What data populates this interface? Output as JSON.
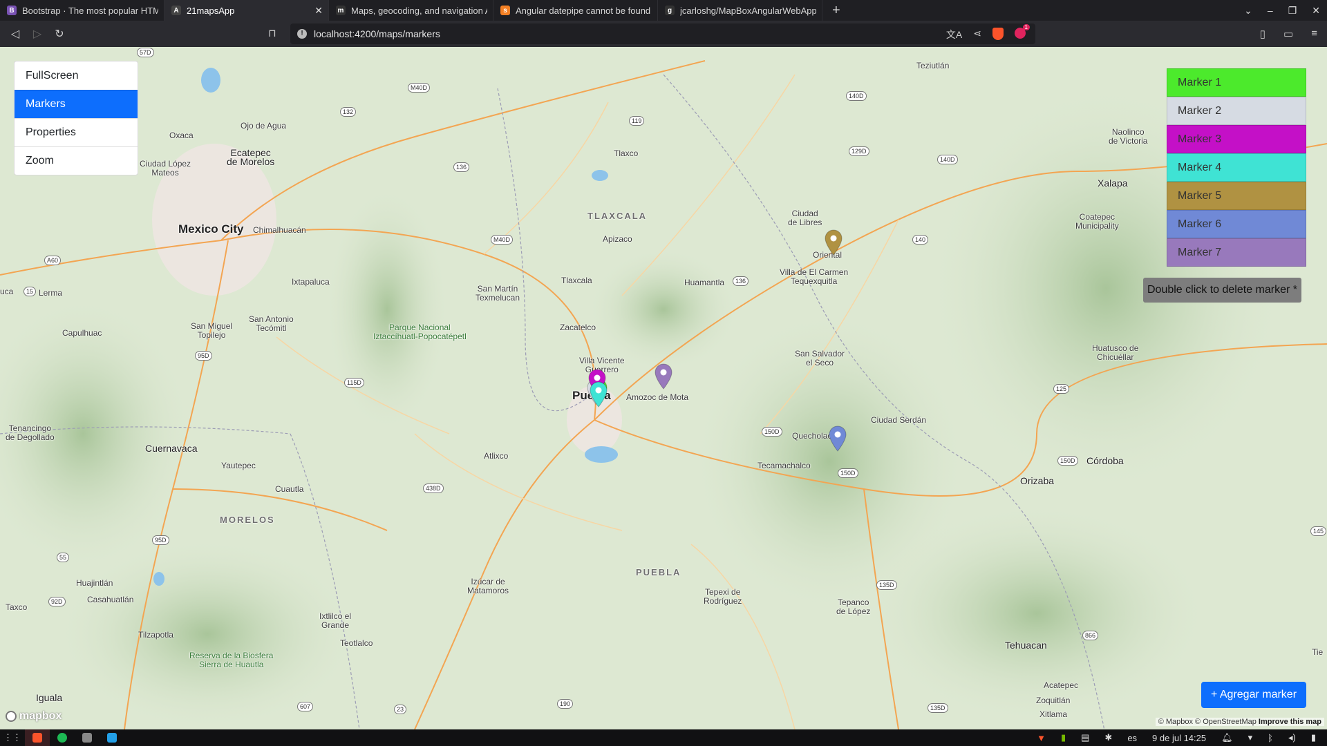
{
  "browser": {
    "tabs": [
      {
        "title": "Bootstrap · The most popular HTML,",
        "favicon": "B",
        "color": "#7952b3",
        "active": false
      },
      {
        "title": "21mapsApp",
        "favicon": "A",
        "color": "#444444",
        "active": true
      },
      {
        "title": "Maps, geocoding, and navigation APIs",
        "favicon": "m",
        "color": "#333333",
        "active": false
      },
      {
        "title": "Angular datepipe cannot be found -",
        "favicon": "s",
        "color": "#f48024",
        "active": false
      },
      {
        "title": "jcarloshg/MapBoxAngularWebApp",
        "favicon": "g",
        "color": "#333333",
        "active": false
      }
    ],
    "url": "localhost:4200/maps/markers"
  },
  "menu": {
    "items": [
      {
        "label": "FullScreen",
        "active": false
      },
      {
        "label": "Markers",
        "active": true
      },
      {
        "label": "Properties",
        "active": false
      },
      {
        "label": "Zoom",
        "active": false
      }
    ]
  },
  "markers": {
    "items": [
      {
        "label": "Marker 1",
        "color": "#4cea2c"
      },
      {
        "label": "Marker 2",
        "color": "#d6dbe3"
      },
      {
        "label": "Marker 3",
        "color": "#c410c7"
      },
      {
        "label": "Marker 4",
        "color": "#3fe3d4"
      },
      {
        "label": "Marker 5",
        "color": "#b09242"
      },
      {
        "label": "Marker 6",
        "color": "#7089d6"
      },
      {
        "label": "Marker 7",
        "color": "#9879bc"
      }
    ],
    "hint": "Double click to delete marker *",
    "add_label": "+ Agregar marker"
  },
  "map": {
    "attribution": "© Mapbox © OpenStreetMap",
    "improve": "Improve this map",
    "logo": "mapbox",
    "places": [
      {
        "name": "Mexico City",
        "cls": "big"
      },
      {
        "name": "Puebla",
        "cls": "big"
      },
      {
        "name": "Cuernavaca",
        "cls": "med"
      },
      {
        "name": "Xalapa",
        "cls": "med"
      },
      {
        "name": "Ecatepec\nde Morelos",
        "cls": "med"
      },
      {
        "name": "Oxaca",
        "cls": ""
      },
      {
        "name": "Ojo de Agua",
        "cls": ""
      },
      {
        "name": "Ciudad López\nMateos",
        "cls": ""
      },
      {
        "name": "Chimalhuacán",
        "cls": ""
      },
      {
        "name": "Ixtapaluca",
        "cls": ""
      },
      {
        "name": "Lerma",
        "cls": ""
      },
      {
        "name": "Capulhuac",
        "cls": ""
      },
      {
        "name": "San Miguel\nTopilejo",
        "cls": ""
      },
      {
        "name": "San Antonio\nTecómitl",
        "cls": ""
      },
      {
        "name": "Parque Nacional\nIztaccíhuatl-Popocatépetl",
        "cls": "park"
      },
      {
        "name": "TLAXCALA",
        "cls": "state"
      },
      {
        "name": "Tlaxco",
        "cls": ""
      },
      {
        "name": "Apizaco",
        "cls": ""
      },
      {
        "name": "Tlaxcala",
        "cls": ""
      },
      {
        "name": "San Martín\nTexmelucan",
        "cls": ""
      },
      {
        "name": "Zacatelco",
        "cls": ""
      },
      {
        "name": "Huamantla",
        "cls": ""
      },
      {
        "name": "Ciudad\nde Libres",
        "cls": ""
      },
      {
        "name": "Oriental",
        "cls": ""
      },
      {
        "name": "Villa de El Carmen\nTequexquitla",
        "cls": ""
      },
      {
        "name": "Teziutlán",
        "cls": ""
      },
      {
        "name": "Naolinco\nde Victoria",
        "cls": ""
      },
      {
        "name": "Coatepec\nMunicipality",
        "cls": ""
      },
      {
        "name": "Villa Vicente\nGuerrero",
        "cls": ""
      },
      {
        "name": "Amozoc de Mota",
        "cls": ""
      },
      {
        "name": "San Salvador\nel Seco",
        "cls": ""
      },
      {
        "name": "Huatusco de\nChicuéllar",
        "cls": ""
      },
      {
        "name": "Ciudad Serdán",
        "cls": ""
      },
      {
        "name": "Quecholac",
        "cls": ""
      },
      {
        "name": "Tecamachalco",
        "cls": ""
      },
      {
        "name": "Córdoba",
        "cls": "med"
      },
      {
        "name": "Orizaba",
        "cls": "med"
      },
      {
        "name": "Tenancingo\nde Degollado",
        "cls": ""
      },
      {
        "name": "Yautepec",
        "cls": ""
      },
      {
        "name": "Cuautla",
        "cls": ""
      },
      {
        "name": "Atlixco",
        "cls": ""
      },
      {
        "name": "MORELOS",
        "cls": "state"
      },
      {
        "name": "PUEBLA",
        "cls": "state"
      },
      {
        "name": "Izúcar de\nMatamoros",
        "cls": ""
      },
      {
        "name": "Tepexi de\nRodríguez",
        "cls": ""
      },
      {
        "name": "Tepanco\nde López",
        "cls": ""
      },
      {
        "name": "Tehuacan",
        "cls": "med"
      },
      {
        "name": "Huajintlán",
        "cls": ""
      },
      {
        "name": "Casahuatlán",
        "cls": ""
      },
      {
        "name": "Taxco",
        "cls": ""
      },
      {
        "name": "Tilzapotla",
        "cls": ""
      },
      {
        "name": "Ixtlilco el\nGrande",
        "cls": ""
      },
      {
        "name": "Teotlalco",
        "cls": ""
      },
      {
        "name": "Reserva de la Biosfera\nSierra de Huautla",
        "cls": "park"
      },
      {
        "name": "Iguala",
        "cls": "med"
      },
      {
        "name": "Acatepec",
        "cls": ""
      },
      {
        "name": "Zoquitlán",
        "cls": ""
      },
      {
        "name": "Xitlama",
        "cls": ""
      },
      {
        "name": "Tie",
        "cls": ""
      },
      {
        "name": "uca",
        "cls": ""
      }
    ],
    "shields": [
      "M40D",
      "132",
      "119",
      "M40D",
      "136",
      "57D",
      "A60",
      "15",
      "95D",
      "115D",
      "136",
      "140",
      "140D",
      "129D",
      "140D",
      "150D",
      "150D",
      "150D",
      "125",
      "438D",
      "135D",
      "866",
      "135D",
      "55",
      "95D",
      "92D",
      "607",
      "23",
      "190",
      "145"
    ]
  },
  "taskbar": {
    "lang": "es",
    "datetime": "9 de jul  14:25"
  }
}
